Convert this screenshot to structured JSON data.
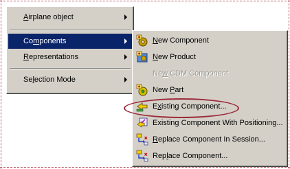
{
  "context_menu": {
    "items": [
      {
        "label": "Airplane object",
        "underline": "A",
        "has_submenu": true,
        "active": false
      },
      {
        "label": "Components",
        "underline": "m",
        "has_submenu": true,
        "active": true
      },
      {
        "label": "Representations",
        "underline": "R",
        "has_submenu": true,
        "active": false
      },
      {
        "label": "Selection Mode",
        "underline": "l",
        "has_submenu": true,
        "active": false
      }
    ],
    "highlight_color": "#0a246a"
  },
  "submenu": {
    "items": [
      {
        "label": "New Component",
        "underline": "N",
        "icon": "new-component-icon",
        "enabled": true
      },
      {
        "label": "New Product",
        "underline": "N",
        "icon": "new-product-icon",
        "enabled": true
      },
      {
        "label": "New CDM Component",
        "underline": "w",
        "icon": "",
        "enabled": false
      },
      {
        "label": "New Part",
        "underline": "P",
        "icon": "new-part-icon",
        "enabled": true
      },
      {
        "label": "Existing Component...",
        "underline": "x",
        "icon": "existing-component-icon",
        "enabled": true
      },
      {
        "label": "Existing Component With Positioning...",
        "underline": "",
        "icon": "existing-component-positioning-icon",
        "enabled": true
      },
      {
        "label": "Replace Component In Session...",
        "underline": "R",
        "icon": "replace-component-in-session-icon",
        "enabled": true
      },
      {
        "label": "Replace Component...",
        "underline": "l",
        "icon": "replace-component-icon",
        "enabled": true
      }
    ]
  },
  "annotation": {
    "highlighted_item": "Existing Component...",
    "color": "#9b2b3a"
  }
}
